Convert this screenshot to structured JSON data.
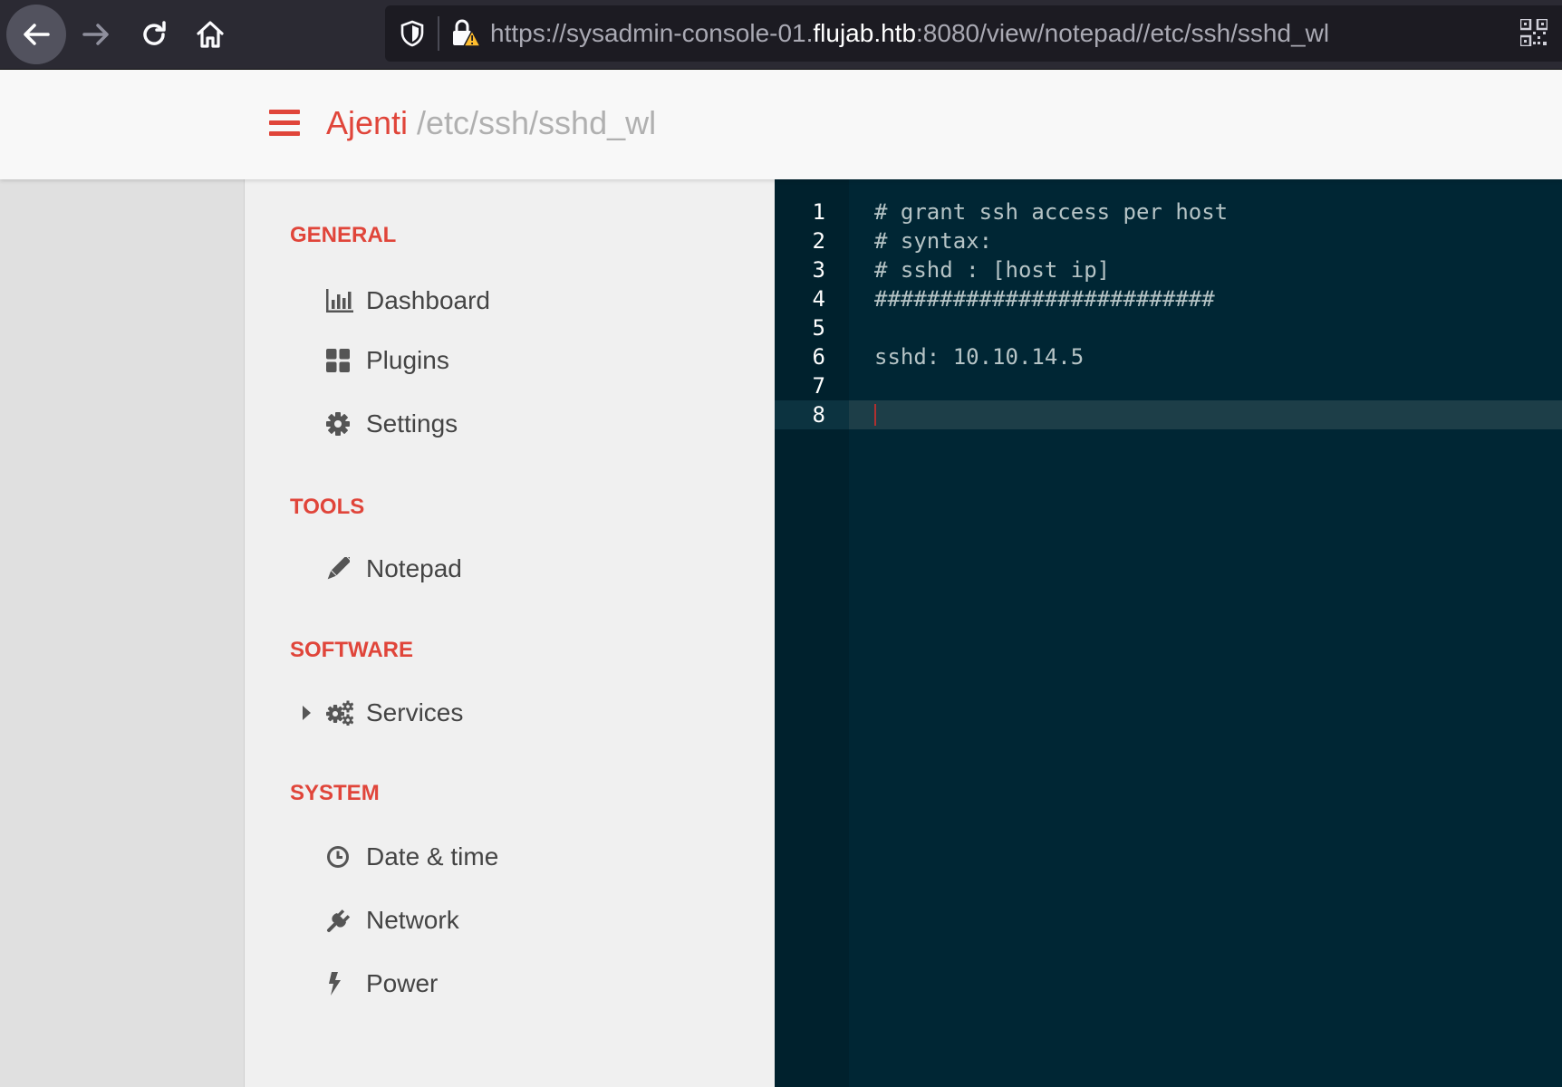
{
  "browser": {
    "url_prefix": "https://sysadmin-console-01.",
    "url_host": "flujab.htb",
    "url_suffix": ":8080/view/notepad//etc/ssh/sshd_wl",
    "icons": [
      "back-arrow-icon",
      "forward-arrow-icon",
      "reload-icon",
      "home-icon",
      "shield-icon",
      "insecure-lock-icon",
      "qr-code-icon"
    ]
  },
  "header": {
    "brand": "Ajenti",
    "path": "/etc/ssh/sshd_wl",
    "accent_color": "#e0453a"
  },
  "sidebar": {
    "sections": [
      {
        "title": "GENERAL",
        "items": [
          {
            "label": "Dashboard",
            "icon": "bar-chart-icon"
          },
          {
            "label": "Plugins",
            "icon": "grid-icon"
          },
          {
            "label": "Settings",
            "icon": "gear-icon"
          }
        ]
      },
      {
        "title": "TOOLS",
        "items": [
          {
            "label": "Notepad",
            "icon": "pencil-icon"
          }
        ]
      },
      {
        "title": "SOFTWARE",
        "items": [
          {
            "label": "Services",
            "icon": "gears-icon",
            "expandable": true
          }
        ]
      },
      {
        "title": "SYSTEM",
        "items": [
          {
            "label": "Date & time",
            "icon": "clock-icon"
          },
          {
            "label": "Network",
            "icon": "plug-icon"
          },
          {
            "label": "Power",
            "icon": "bolt-icon"
          }
        ]
      }
    ]
  },
  "editor": {
    "background": "#002634",
    "active_line": 8,
    "lines": [
      {
        "num": "1",
        "text": "# grant ssh access per host"
      },
      {
        "num": "2",
        "text": "# syntax:"
      },
      {
        "num": "3",
        "text": "# sshd : [host ip]"
      },
      {
        "num": "4",
        "text": "##########################"
      },
      {
        "num": "5",
        "text": ""
      },
      {
        "num": "6",
        "text": "sshd: 10.10.14.5"
      },
      {
        "num": "7",
        "text": ""
      },
      {
        "num": "8",
        "text": ""
      }
    ]
  }
}
